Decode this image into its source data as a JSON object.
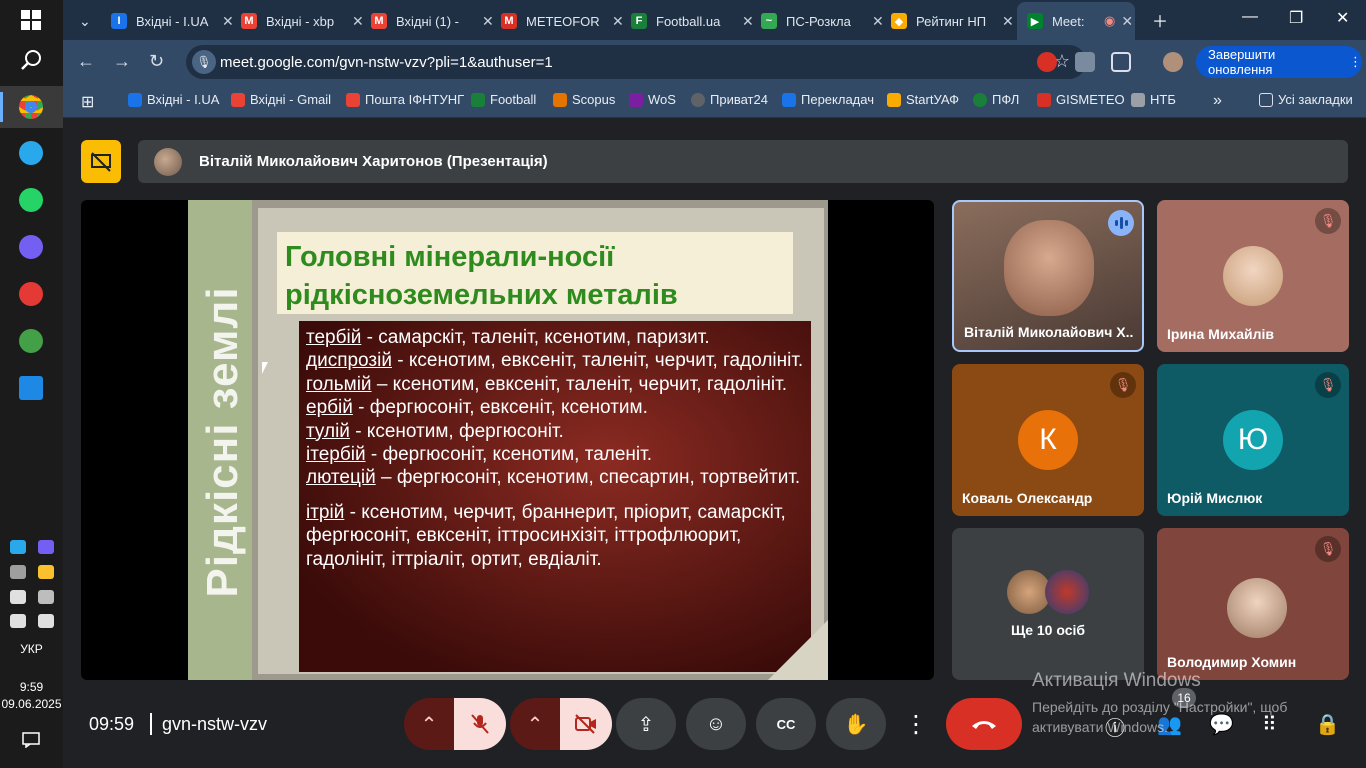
{
  "browser": {
    "tabs": [
      {
        "title": "Вхідні - I.UA",
        "color": "#1a73e8",
        "icon": "I"
      },
      {
        "title": "Вхідні - xbp",
        "color": "#ea4335",
        "icon": "M"
      },
      {
        "title": "Вхідні (1) -",
        "color": "#ea4335",
        "icon": "M"
      },
      {
        "title": "METEOFOR",
        "color": "#d93025",
        "icon": "M"
      },
      {
        "title": "Football.ua",
        "color": "#188038",
        "icon": "F"
      },
      {
        "title": "ПС-Розкла",
        "color": "#34a853",
        "icon": "~"
      },
      {
        "title": "Рейтинг НП",
        "color": "#f9ab00",
        "icon": "◆"
      },
      {
        "title": "Meet: ",
        "color": "#00832d",
        "icon": "▶"
      }
    ],
    "url": "meet.google.com/gvn-nstw-vzv?pli=1&authuser=1",
    "update_button": "Завершити оновлення",
    "bookmarks": [
      {
        "label": "Вхідні - I.UA",
        "color": "#1a73e8"
      },
      {
        "label": "Вхідні - Gmail",
        "color": "#ea4335"
      },
      {
        "label": "Пошта ІФНТУНГ",
        "color": "#ea4335"
      },
      {
        "label": "Football",
        "color": "#188038"
      },
      {
        "label": "Scopus",
        "color": "#e37400"
      },
      {
        "label": "WoS",
        "color": "#7b1fa2"
      },
      {
        "label": "Приват24",
        "color": "#5f6368"
      },
      {
        "label": "Перекладач",
        "color": "#1a73e8"
      },
      {
        "label": "StartУАФ",
        "color": "#f9ab00"
      },
      {
        "label": "ПФЛ",
        "color": "#188038"
      },
      {
        "label": "GISMETEO",
        "color": "#d93025"
      },
      {
        "label": "НТБ",
        "color": "#9aa0a6"
      }
    ],
    "all_bookmarks": "Усі закладки"
  },
  "meet": {
    "presenter": "Віталій Миколайович Харитонов (Презентація)",
    "slide": {
      "side_title": "Рідкісні землі",
      "title": "Головні мінерали-носії рідкісноземельних металів",
      "lines": [
        {
          "term": "тербій",
          "text": " - самарскіт, таленіт, ксенотим, паризит."
        },
        {
          "term": "диспрозій",
          "text": " - ксенотим, евксеніт, таленіт, черчит, гадолініт."
        },
        {
          "term": "гольмій",
          "text": " – ксенотим, евксеніт, таленіт, черчит, гадолініт."
        },
        {
          "term": "ербій",
          "text": " - фергюсоніт, евксеніт, ксенотим."
        },
        {
          "term": "тулій",
          "text": " - ксенотим, фергюсоніт."
        },
        {
          "term": "ітербій",
          "text": " - фергюсоніт, ксенотим, таленіт."
        },
        {
          "term": "лютецій",
          "text": " – фергюсоніт, ксенотим, спесартин, тортвейтит."
        }
      ],
      "extra": {
        "term": "ітрій",
        "text": " - ксенотим, черчит, браннерит, пріорит, самарскіт, фергюсоніт, евксеніт, іттросинхізіт, іттрофлюорит, гадолініт, іттріаліт, ортит, евдіаліт."
      }
    },
    "participants": [
      {
        "name": "Віталій Миколайович Х...",
        "state": "speaking"
      },
      {
        "name": "Ірина Михайлів",
        "state": "muted"
      },
      {
        "name": "Коваль Олександр",
        "letter": "К",
        "color": "#e8710a",
        "state": "muted"
      },
      {
        "name": "Юрій Мислюк",
        "letter": "Ю",
        "color": "#12a4af",
        "state": "muted"
      },
      {
        "name": "Ще 10 осіб",
        "state": "group"
      },
      {
        "name": "Володимир Хомин",
        "state": "muted"
      }
    ],
    "time": "09:59",
    "meeting_code": "gvn-nstw-vzv",
    "participant_count": "16"
  },
  "taskbar": {
    "language": "УКР",
    "time": "9:59",
    "date": "09.06.2025"
  },
  "watermark": {
    "line1": "Активація Windows",
    "line2": "Перейдіть до розділу \"Настройки\", щоб активувати Windows."
  }
}
